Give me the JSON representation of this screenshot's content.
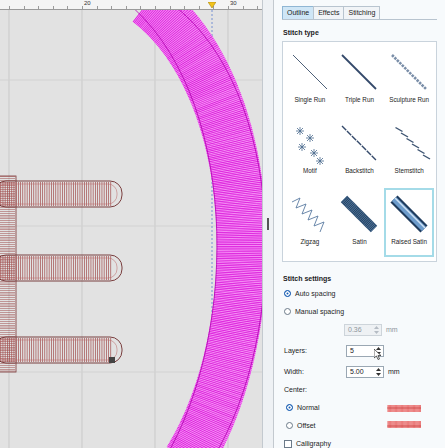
{
  "ruler": {
    "ticks": [
      "20",
      "30"
    ]
  },
  "panel": {
    "tabs": [
      {
        "label": "Outline",
        "selected": true
      },
      {
        "label": "Effects",
        "selected": false
      },
      {
        "label": "Stitching",
        "selected": false
      }
    ],
    "stitch_type": {
      "title": "Stitch type",
      "items": [
        {
          "label": "Single Run",
          "kind": "single",
          "selected": false
        },
        {
          "label": "Triple Run",
          "kind": "triple",
          "selected": false
        },
        {
          "label": "Sculpture Run",
          "kind": "sculpture",
          "selected": false
        },
        {
          "label": "Motif",
          "kind": "motif",
          "selected": false
        },
        {
          "label": "Backstitch",
          "kind": "back",
          "selected": false
        },
        {
          "label": "Stemstitch",
          "kind": "stem",
          "selected": false
        },
        {
          "label": "Zigzag",
          "kind": "zigzag",
          "selected": false
        },
        {
          "label": "Satin",
          "kind": "satin",
          "selected": false
        },
        {
          "label": "Raised Satin",
          "kind": "raised",
          "selected": true
        }
      ]
    },
    "stitch_settings": {
      "title": "Stitch settings",
      "spacing": [
        {
          "label": "Auto spacing",
          "selected": true
        },
        {
          "label": "Manual spacing",
          "selected": false
        }
      ],
      "manual_value": {
        "value": "0.36",
        "unit": "mm",
        "disabled": true
      },
      "layers": {
        "label": "Layers:",
        "value": "5"
      },
      "width": {
        "label": "Width:",
        "value": "5.00",
        "unit": "mm"
      },
      "center": {
        "label": "Center:",
        "options": [
          {
            "label": "Normal",
            "selected": true
          },
          {
            "label": "Offset",
            "selected": false
          }
        ]
      },
      "calligraphy": {
        "label": "Calligraphy",
        "checked": false
      }
    }
  }
}
